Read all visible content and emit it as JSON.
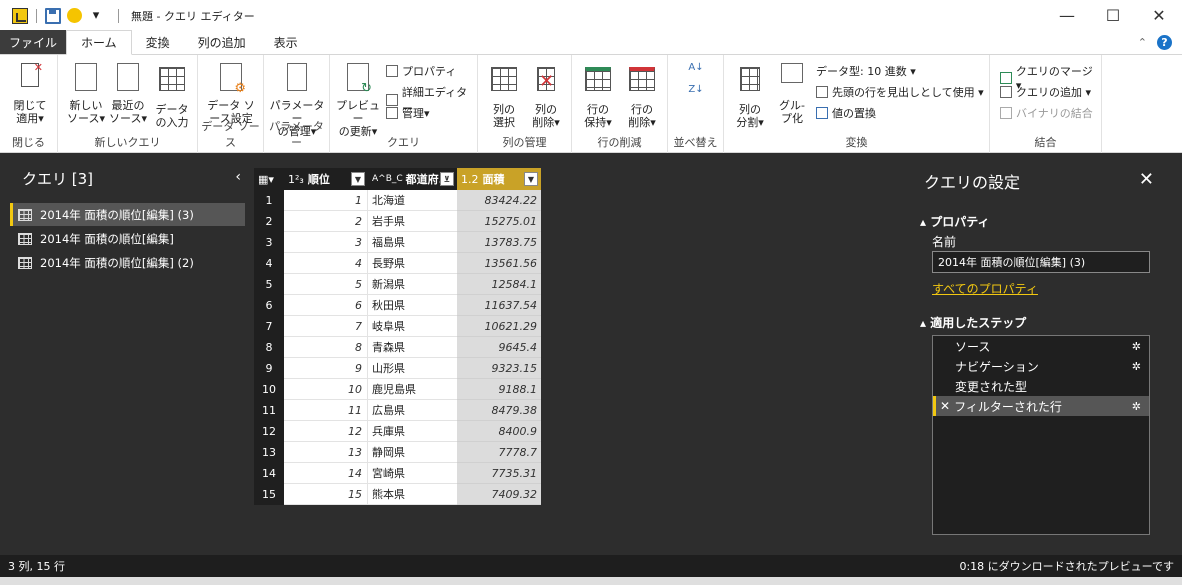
{
  "title_bar": {
    "title": "無題 - クエリ エディター",
    "quick_dropdown": "▾"
  },
  "menu": {
    "file": "ファイル",
    "tabs": [
      "ホーム",
      "変換",
      "列の追加",
      "表示"
    ]
  },
  "ribbon": {
    "close": {
      "label1": "閉じて",
      "label2": "適用▾",
      "group": "閉じる"
    },
    "new_query": {
      "new1": "新しい",
      "new2": "ソース▾",
      "recent1": "最近の",
      "recent2": "ソース▾",
      "enter1": "データ",
      "enter2": "の入力",
      "group": "新しいクエリ"
    },
    "data_source": {
      "label1": "データ ソ",
      "label2": "ース設定",
      "group": "データ ソース"
    },
    "params": {
      "label1": "パラメーター",
      "label2": "の管理▾",
      "group": "パラメーター"
    },
    "query": {
      "preview1": "プレビュー",
      "preview2": "の更新▾",
      "properties": "プロパティ",
      "advanced": "詳細エディター",
      "manage": "管理▾",
      "group": "クエリ"
    },
    "columns": {
      "select1": "列の",
      "select2": "選択",
      "remove1": "列の",
      "remove2": "削除▾",
      "group": "列の管理"
    },
    "rows": {
      "keep1": "行の",
      "keep2": "保持▾",
      "remove1": "行の",
      "remove2": "削除▾",
      "group": "行の削減"
    },
    "sort": {
      "group": "並べ替え"
    },
    "transform": {
      "split1": "列の",
      "split2": "分割▾",
      "group1": "グル-",
      "group2": "プ化",
      "datatype": "データ型: 10 進数 ▾",
      "header": "先頭の行を見出しとして使用 ▾",
      "replace": "値の置換",
      "group": "変換"
    },
    "combine": {
      "merge": "クエリのマージ ▾",
      "append": "クエリの追加 ▾",
      "binary": "バイナリの結合",
      "group": "結合"
    }
  },
  "left_pane": {
    "title": "クエリ [3]",
    "collapse": "‹",
    "queries": [
      "2014年 面積の順位[編集] (3)",
      "2014年 面積の順位[編集]",
      "2014年 面積の順位[編集] (2)"
    ]
  },
  "table": {
    "headers": {
      "rank": "順位",
      "rank_type": "1²₃",
      "pref": "都道府...",
      "pref_type": "A^B_C",
      "area": "面積",
      "area_type": "1.2"
    },
    "rows": [
      {
        "i": "1",
        "rank": "1",
        "pref": "北海道",
        "area": "83424.22"
      },
      {
        "i": "2",
        "rank": "2",
        "pref": "岩手県",
        "area": "15275.01"
      },
      {
        "i": "3",
        "rank": "3",
        "pref": "福島県",
        "area": "13783.75"
      },
      {
        "i": "4",
        "rank": "4",
        "pref": "長野県",
        "area": "13561.56"
      },
      {
        "i": "5",
        "rank": "5",
        "pref": "新潟県",
        "area": "12584.1"
      },
      {
        "i": "6",
        "rank": "6",
        "pref": "秋田県",
        "area": "11637.54"
      },
      {
        "i": "7",
        "rank": "7",
        "pref": "岐阜県",
        "area": "10621.29"
      },
      {
        "i": "8",
        "rank": "8",
        "pref": "青森県",
        "area": "9645.4"
      },
      {
        "i": "9",
        "rank": "9",
        "pref": "山形県",
        "area": "9323.15"
      },
      {
        "i": "10",
        "rank": "10",
        "pref": "鹿児島県",
        "area": "9188.1"
      },
      {
        "i": "11",
        "rank": "11",
        "pref": "広島県",
        "area": "8479.38"
      },
      {
        "i": "12",
        "rank": "12",
        "pref": "兵庫県",
        "area": "8400.9"
      },
      {
        "i": "13",
        "rank": "13",
        "pref": "静岡県",
        "area": "7778.7"
      },
      {
        "i": "14",
        "rank": "14",
        "pref": "宮崎県",
        "area": "7735.31"
      },
      {
        "i": "15",
        "rank": "15",
        "pref": "熊本県",
        "area": "7409.32"
      }
    ]
  },
  "right_pane": {
    "title": "クエリの設定",
    "properties_header": "▴ プロパティ",
    "name_label": "名前",
    "name_value": "2014年 面積の順位[編集] (3)",
    "all_properties": "すべてのプロパティ",
    "steps_header": "▴ 適用したステップ",
    "steps": [
      "ソース",
      "ナビゲーション",
      "変更された型",
      "フィルターされた行"
    ]
  },
  "status": {
    "left": "3 列, 15 行",
    "right": "0:18 にダウンロードされたプレビューです"
  }
}
